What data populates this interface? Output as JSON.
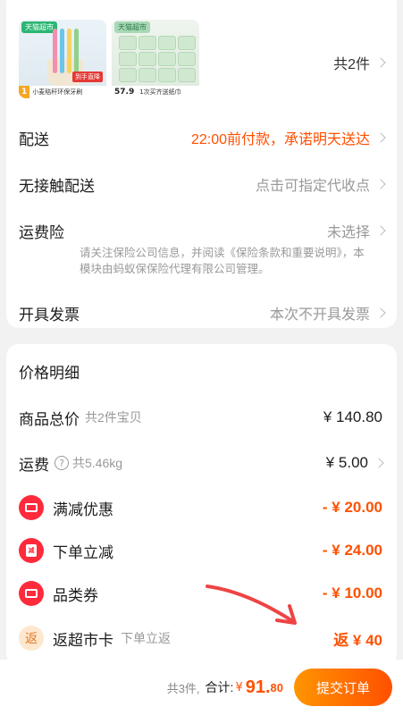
{
  "products": {
    "item1": {
      "store_tag": "天猫超市",
      "price_tail": "1",
      "promo": "到手直降",
      "title": "小麦秸秆环保牙刷"
    },
    "item2": {
      "store_tag": "天猫超市",
      "price_tail": "57.9",
      "title": "1次买齐送纸巾"
    },
    "count": "共2件"
  },
  "delivery": {
    "label": "配送",
    "value": "22:00前付款，承诺明天送达"
  },
  "contactless": {
    "label": "无接触配送",
    "value": "点击可指定代收点"
  },
  "shipping_insurance": {
    "label": "运费险",
    "value": "未选择",
    "note": "请关注保险公司信息，并阅读《保险条款和重要说明》，本模块由蚂蚁保保险代理有限公司管理。"
  },
  "invoice": {
    "label": "开具发票",
    "value": "本次不开具发票"
  },
  "price_detail": {
    "title": "价格明细",
    "goods_total": {
      "label": "商品总价",
      "sub": "共2件宝贝",
      "value": "¥ 140.80"
    },
    "freight": {
      "label": "运费",
      "sub": "共5.46kg",
      "value": "¥ 5.00"
    },
    "full_reduction": {
      "label": "满减优惠",
      "value": "- ¥ 20.00"
    },
    "order_discount": {
      "label": "下单立减",
      "icon_text": "减",
      "value": "- ¥ 24.00"
    },
    "category_coupon": {
      "label": "品类券",
      "value": "- ¥ 10.00"
    },
    "supermarket_card": {
      "label": "返超市卡",
      "icon_text": "返",
      "sub": "下单立返",
      "value": "返 ¥ 40"
    }
  },
  "footer": {
    "count": "共3件,",
    "total_label": "合计:",
    "currency": "¥",
    "total_int": "91.",
    "total_dec": "80",
    "submit": "提交订单"
  },
  "colors": {
    "accent": "#ff5000",
    "coupon_red": "#ff2a3b",
    "annotation_arrow": "#ee4444"
  }
}
